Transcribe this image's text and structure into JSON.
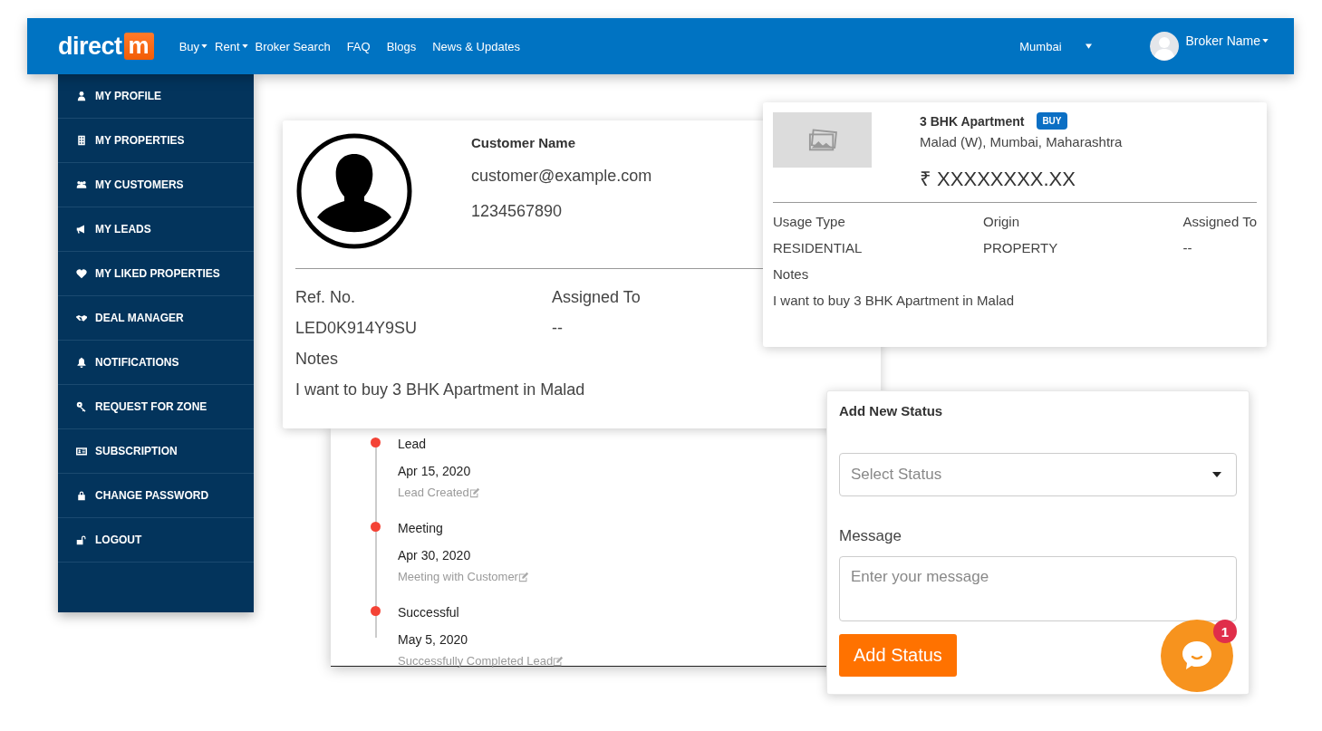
{
  "navbar": {
    "logo": {
      "text": "direct",
      "mark": "m"
    },
    "links": [
      {
        "label": "Buy",
        "dropdown": true
      },
      {
        "label": "Rent",
        "dropdown": true
      },
      {
        "label": "Broker Search",
        "dropdown": false
      },
      {
        "label": "FAQ",
        "dropdown": false
      },
      {
        "label": "Blogs",
        "dropdown": false
      },
      {
        "label": "News & Updates",
        "dropdown": false
      }
    ],
    "city": "Mumbai",
    "user": "Broker Name"
  },
  "sidebar": {
    "items": [
      {
        "label": "MY PROFILE"
      },
      {
        "label": "MY PROPERTIES"
      },
      {
        "label": "MY CUSTOMERS"
      },
      {
        "label": "MY LEADS"
      },
      {
        "label": "MY LIKED PROPERTIES"
      },
      {
        "label": "DEAL MANAGER"
      },
      {
        "label": "NOTIFICATIONS"
      },
      {
        "label": "REQUEST FOR ZONE"
      },
      {
        "label": "SUBSCRIPTION"
      },
      {
        "label": "CHANGE PASSWORD"
      },
      {
        "label": "LOGOUT"
      }
    ]
  },
  "customer": {
    "name": "Customer Name",
    "email": "customer@example.com",
    "phone": "1234567890",
    "fields": [
      {
        "label": "Ref. No.",
        "value": "LED0K914Y9SU"
      },
      {
        "label": "Assigned To",
        "value": "--"
      }
    ],
    "notes_label": "Notes",
    "notes": "I want to buy 3 BHK Apartment in Malad"
  },
  "timeline": [
    {
      "title": "Lead",
      "date": "Apr 15, 2020",
      "note": "Lead Created"
    },
    {
      "title": "Meeting",
      "date": "Apr 30, 2020",
      "note": "Meeting with Customer"
    },
    {
      "title": "Successful",
      "date": "May 5, 2020",
      "note": "Successfully Completed Lead"
    }
  ],
  "property": {
    "title": "3 BHK Apartment",
    "badge": "BUY",
    "location": "Malad (W), Mumbai, Maharashtra",
    "price": "₹ XXXXXXXX.XX",
    "fields": [
      {
        "label": "Usage Type",
        "value": "RESIDENTIAL"
      },
      {
        "label": "Origin",
        "value": "PROPERTY"
      },
      {
        "label": "Assigned To",
        "value": "--"
      }
    ],
    "notes_label": "Notes",
    "notes": "I want to buy 3 BHK Apartment in Malad"
  },
  "status_form": {
    "title": "Add New Status",
    "select": {
      "placeholder": "Select Status"
    },
    "message_label": "Message",
    "message": {
      "placeholder": "Enter your message"
    },
    "button": "Add Status"
  },
  "chat": {
    "badge": "1"
  }
}
